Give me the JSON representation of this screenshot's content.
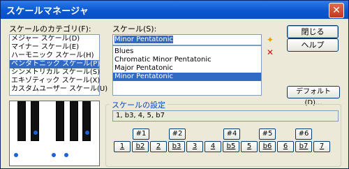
{
  "window": {
    "title": "スケールマネージャ",
    "close_icon": "close-icon"
  },
  "category": {
    "label": "スケールのカテゴリ(F):",
    "items": [
      {
        "label": "メジャー スケール(D)",
        "selected": false
      },
      {
        "label": "マイナー スケール(E)",
        "selected": false
      },
      {
        "label": "ハーモニック スケール(H)",
        "selected": false
      },
      {
        "label": "ペンタトニック スケール(P)",
        "selected": true
      },
      {
        "label": "シンメトリカル スケール(S)",
        "selected": false
      },
      {
        "label": "エキゾティック スケール(X)",
        "selected": false
      },
      {
        "label": "カスタムユーザー スケール(U)",
        "selected": false
      }
    ]
  },
  "scale": {
    "label": "スケール(S):",
    "input_value": "Minor Pentatonic",
    "items": [
      {
        "label": "Blues",
        "selected": false
      },
      {
        "label": "Chromatic Minor Pentatonic",
        "selected": false
      },
      {
        "label": "Major Pentatonic",
        "selected": false
      },
      {
        "label": "Minor Pentatonic",
        "selected": true
      }
    ]
  },
  "buttons": {
    "close": "閉じる",
    "help": "ヘルプ",
    "default": "デフォルト(D)..."
  },
  "icons": {
    "add": "star-add-icon",
    "delete": "delete-x-icon"
  },
  "settings": {
    "group_label": "スケールの設定",
    "formula": "1, b3, 4, 5, b7",
    "sharps": [
      "#1",
      "#2",
      "#4",
      "#5",
      "#6"
    ],
    "degrees": [
      {
        "label": "1",
        "active": false
      },
      {
        "label": "b2",
        "active": false
      },
      {
        "label": "2",
        "active": false
      },
      {
        "label": "b3",
        "active": false
      },
      {
        "label": "3",
        "active": false
      },
      {
        "label": "4",
        "active": false
      },
      {
        "label": "b5",
        "active": false
      },
      {
        "label": "5",
        "active": false
      },
      {
        "label": "b6",
        "active": false
      },
      {
        "label": "6",
        "active": false
      },
      {
        "label": "b7",
        "active": false
      },
      {
        "label": "7",
        "active": false
      }
    ]
  },
  "colors": {
    "titlebar": "#0b57d0",
    "selection": "#316ac5",
    "dialog_bg": "#ece9d8",
    "piano_dot": "#1b62d8"
  }
}
